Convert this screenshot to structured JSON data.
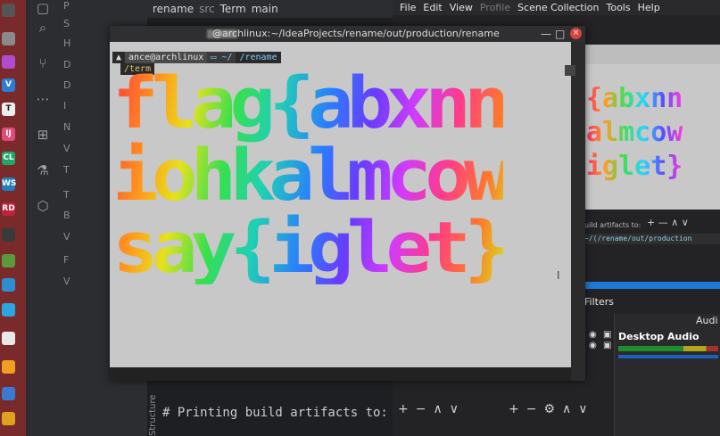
{
  "ide": {
    "breadcrumbs": [
      "rename",
      "src",
      "Term",
      "main"
    ],
    "tree_labels": [
      "P",
      "S",
      "H",
      "D",
      "D",
      "I",
      "N",
      "V",
      "T",
      "T",
      "B",
      "V",
      "F",
      "V"
    ],
    "structure_label": "Structure",
    "code_line": "# Printing build artifacts to:"
  },
  "terminal": {
    "title": "@archlinux:~/IdeaProjects/rename/out/production/rename",
    "prompt_user": "ance@archlinux",
    "prompt_path_home": "~",
    "prompt_path_sep": "/",
    "prompt_path_last": "/rename",
    "prompt_line2": "/term",
    "figlet_line1": "flag{abxnn",
    "figlet_line2": "iohkalmcow",
    "figlet_line3": "say{iglet}",
    "buttons": {
      "minimize": "—",
      "maximize": "□",
      "close": "×"
    }
  },
  "obs": {
    "menu": {
      "file": "File",
      "edit": "Edit",
      "view": "View",
      "profile": "Profile",
      "scene_collection": "Scene Collection",
      "tools": "Tools",
      "help": "Help"
    },
    "preview_text": "{abxnn\nalmcow\niglet}",
    "preview_status": "uild artifacts to:",
    "preview_termbar": "~/(/rename/out/production",
    "filters_label": "Filters",
    "audio_title": "Audi",
    "desktop_audio": "Desktop Audio"
  },
  "colors": {
    "terminal_bg": "#c8c8c8",
    "obs_accent": "#1e7ad6",
    "dock_bg": "#7a2a2a"
  },
  "icons": {
    "ide_tools": [
      "folder-icon",
      "search-icon",
      "git-icon",
      "plugins-icon",
      "flask-icon",
      "shapes-icon"
    ],
    "dock": [
      "firefox-icon",
      "vscode-icon",
      "typora-icon",
      "intellij-icon",
      "clion-icon",
      "webstorm-icon",
      "rider-icon",
      "minecraft-icon",
      "telegram-icon",
      "calendar-icon"
    ]
  }
}
